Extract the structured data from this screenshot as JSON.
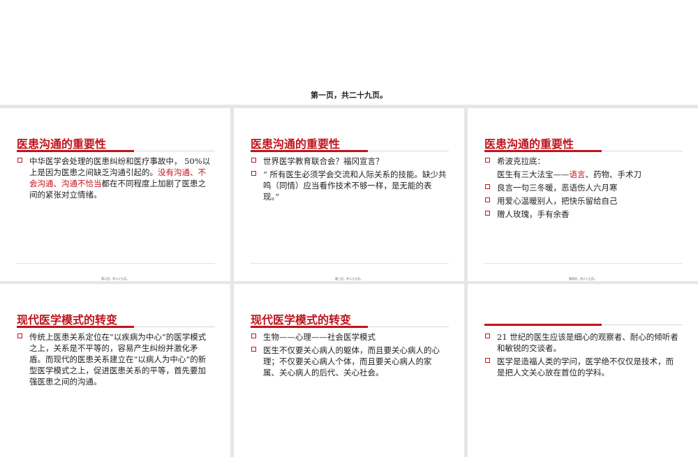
{
  "top": {
    "caption": "第一页，共二十九页。"
  },
  "slides": [
    {
      "title": "医患沟通的重要性",
      "footer": "第二页，共二十九页。",
      "bullets": [
        {
          "segments": [
            {
              "text": "中华医学会处理的医患纠纷和医疗事故中， 50%以上是因为医患之间缺乏沟通引起的。",
              "red": false
            },
            {
              "text": "没有沟通、不会沟通、沟通不恰当",
              "red": true
            },
            {
              "text": "都在不同程度上加剧了医患之间的紧张对立情绪。",
              "red": false
            }
          ]
        }
      ]
    },
    {
      "title": "医患沟通的重要性",
      "footer": "第三页，共二十九页。",
      "bullets": [
        {
          "segments": [
            {
              "text": "世界医学教育联合会？福冈宣言？",
              "red": false
            }
          ]
        },
        {
          "segments": [
            {
              "text": "“ 所有医生必须学会交流和人际关系的技能。缺少共鸣（同情）应当看作技术不够一样，是无能的表现。”",
              "red": false
            }
          ]
        }
      ]
    },
    {
      "title": "医患沟通的重要性",
      "footer": "第四页，共二十九页。",
      "bullets": [
        {
          "segments": [
            {
              "text": "希波克拉底：",
              "red": false
            }
          ]
        },
        {
          "plain": true,
          "segments": [
            {
              "text": "医生有三大法宝——",
              "red": false
            },
            {
              "text": "语言",
              "red": true
            },
            {
              "text": "、药物、手术刀",
              "red": false
            }
          ]
        },
        {
          "segments": [
            {
              "text": "良言一句三冬暖，恶语伤人六月寒",
              "red": false
            }
          ]
        },
        {
          "segments": [
            {
              "text": "用爱心温暖别人，把快乐留给自己",
              "red": false
            }
          ]
        },
        {
          "segments": [
            {
              "text": "赠人玫瑰，手有余香",
              "red": false
            }
          ]
        }
      ]
    },
    {
      "title": "现代医学模式的转变",
      "footer": "",
      "bullets": [
        {
          "segments": [
            {
              "text": "传统上医患关系定位在“以疾病为中心”的医学模式之上，关系是不平等的，容易产生纠纷并激化矛盾。而现代的医患关系建立在“以病人为中心”的新型医学模式之上，促进医患关系的平等，首先要加强医患之间的沟通。",
              "red": false
            }
          ]
        }
      ]
    },
    {
      "title": "现代医学模式的转变",
      "footer": "",
      "bullets": [
        {
          "segments": [
            {
              "text": "生物——心理——社会医学模式",
              "red": false
            }
          ]
        },
        {
          "segments": [
            {
              "text": "医生不仅要关心病人的躯体，而且要关心病人的心理；不仅要关心病人个体，而且要关心病人的家属、关心病人的后代、关心社会。",
              "red": false
            }
          ]
        }
      ]
    },
    {
      "title": "",
      "footer": "",
      "bullets": [
        {
          "segments": [
            {
              "text": "21 世纪的医生应该是细心的观察者、耐心的倾听者和敏锐的交谈者。",
              "red": false
            }
          ]
        },
        {
          "segments": [
            {
              "text": "医学是造福人类的学问，医学绝不仅仅是技术，而是把人文关心放在首位的学科。",
              "red": false
            }
          ]
        }
      ]
    }
  ]
}
